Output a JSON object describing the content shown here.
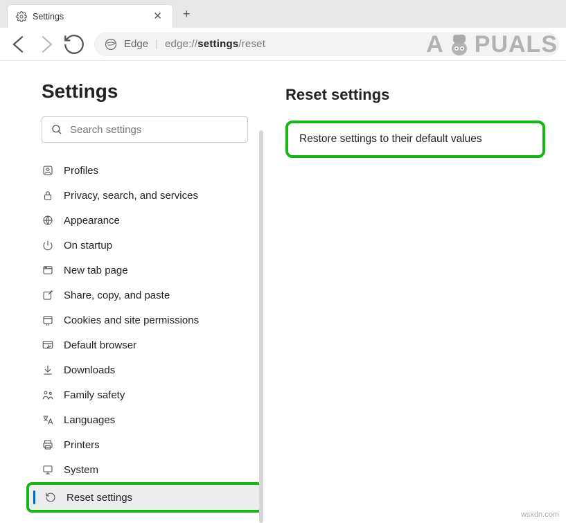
{
  "tab": {
    "title": "Settings"
  },
  "address": {
    "scheme_label": "Edge",
    "url_prefix": "edge://",
    "url_bold": "settings",
    "url_suffix": "/reset"
  },
  "sidebar": {
    "title": "Settings",
    "search_placeholder": "Search settings",
    "items": [
      {
        "icon": "profiles",
        "label": "Profiles"
      },
      {
        "icon": "lock",
        "label": "Privacy, search, and services"
      },
      {
        "icon": "appearance",
        "label": "Appearance"
      },
      {
        "icon": "power",
        "label": "On startup"
      },
      {
        "icon": "newtab",
        "label": "New tab page"
      },
      {
        "icon": "share",
        "label": "Share, copy, and paste"
      },
      {
        "icon": "cookies",
        "label": "Cookies and site permissions"
      },
      {
        "icon": "browser",
        "label": "Default browser"
      },
      {
        "icon": "download",
        "label": "Downloads"
      },
      {
        "icon": "family",
        "label": "Family safety"
      },
      {
        "icon": "lang",
        "label": "Languages"
      },
      {
        "icon": "printer",
        "label": "Printers"
      },
      {
        "icon": "system",
        "label": "System"
      },
      {
        "icon": "reset",
        "label": "Reset settings"
      }
    ]
  },
  "main": {
    "title": "Reset settings",
    "restore_label": "Restore settings to their default values"
  },
  "watermark": {
    "text_a": "A",
    "text_b": "PUALS"
  },
  "credit": "wsxdn.com"
}
